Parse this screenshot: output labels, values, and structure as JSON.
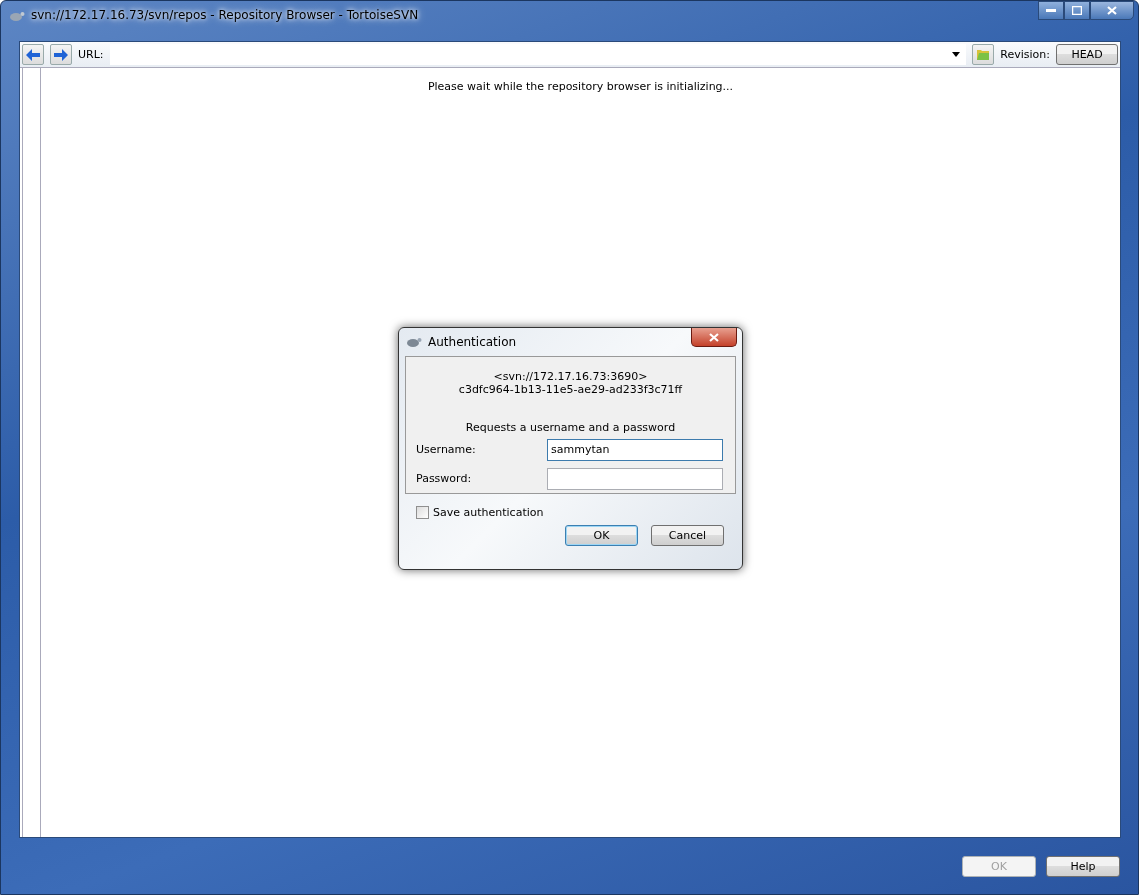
{
  "window": {
    "title": "svn://172.17.16.73/svn/repos - Repository Browser - TortoiseSVN"
  },
  "toolbar": {
    "url_label": "URL:",
    "revision_label": "Revision:",
    "revision_button": "HEAD"
  },
  "browser": {
    "status": "Please wait while the repository browser is initializing..."
  },
  "footer_buttons": [
    {
      "label": "OK",
      "disabled": true
    },
    {
      "label": "Help",
      "disabled": false
    }
  ],
  "dialog": {
    "title": "Authentication",
    "realm": "<svn://172.17.16.73:3690>",
    "uuid": "c3dfc964-1b13-11e5-ae29-ad233f3c71ff",
    "prompt": "Requests a username and a password",
    "fields": [
      {
        "label": "Username:",
        "value": "sammytan",
        "focused": true
      },
      {
        "label": "Password:",
        "focused": false
      }
    ],
    "save_authentication": {
      "label": "Save authentication",
      "checked": false
    },
    "buttons": [
      {
        "label": "OK",
        "default": true
      },
      {
        "label": "Cancel",
        "default": false
      }
    ]
  }
}
